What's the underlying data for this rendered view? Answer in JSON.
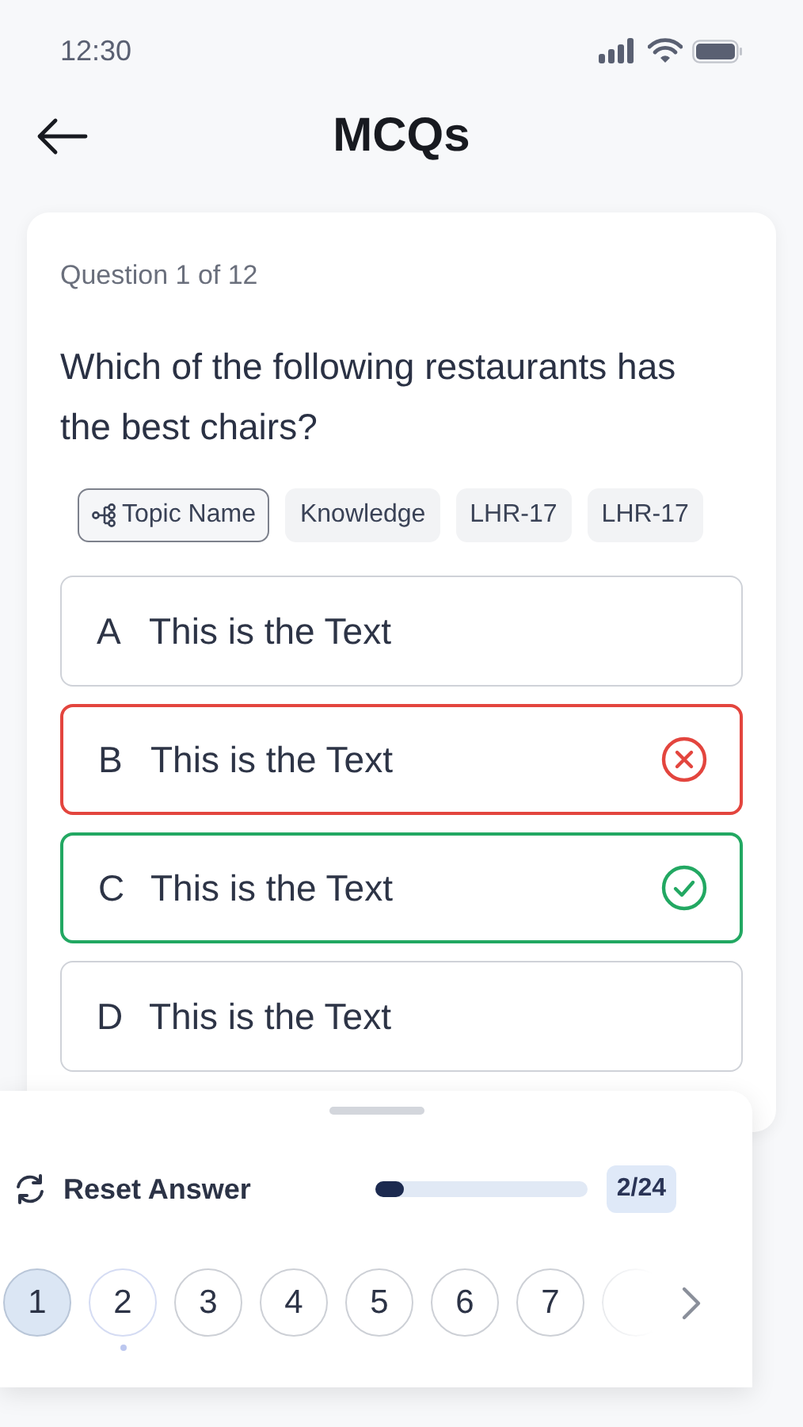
{
  "status_bar": {
    "time": "12:30"
  },
  "header": {
    "title": "MCQs"
  },
  "question": {
    "counter": "Question 1 of 12",
    "text": "Which of the following restaurants has the best chairs?",
    "tags": [
      {
        "label": "Topic Name",
        "kind": "topic"
      },
      {
        "label": "Knowledge",
        "kind": "plain"
      },
      {
        "label": "LHR-17",
        "kind": "plain"
      },
      {
        "label": "LHR-17",
        "kind": "plain"
      }
    ],
    "options": [
      {
        "letter": "A",
        "text": "This is the Text",
        "kind": "plain"
      },
      {
        "letter": "B",
        "text": "This is the Text",
        "kind": "wrong"
      },
      {
        "letter": "C",
        "text": "This is the Text",
        "kind": "correct"
      },
      {
        "letter": "D",
        "text": "This is the Text",
        "kind": "plain"
      }
    ]
  },
  "sheet": {
    "reset_label": "Reset Answer",
    "progress": {
      "level": 0.08,
      "reading": "2/24"
    },
    "questions": [
      {
        "label": "1",
        "selected": true,
        "current": false
      },
      {
        "label": "2",
        "selected": false,
        "current": true
      },
      {
        "label": "3",
        "selected": false,
        "current": false
      },
      {
        "label": "4",
        "selected": false,
        "current": false
      },
      {
        "label": "5",
        "selected": false,
        "current": false
      },
      {
        "label": "6",
        "selected": false,
        "current": false
      },
      {
        "label": "7",
        "selected": false,
        "current": false
      }
    ]
  }
}
